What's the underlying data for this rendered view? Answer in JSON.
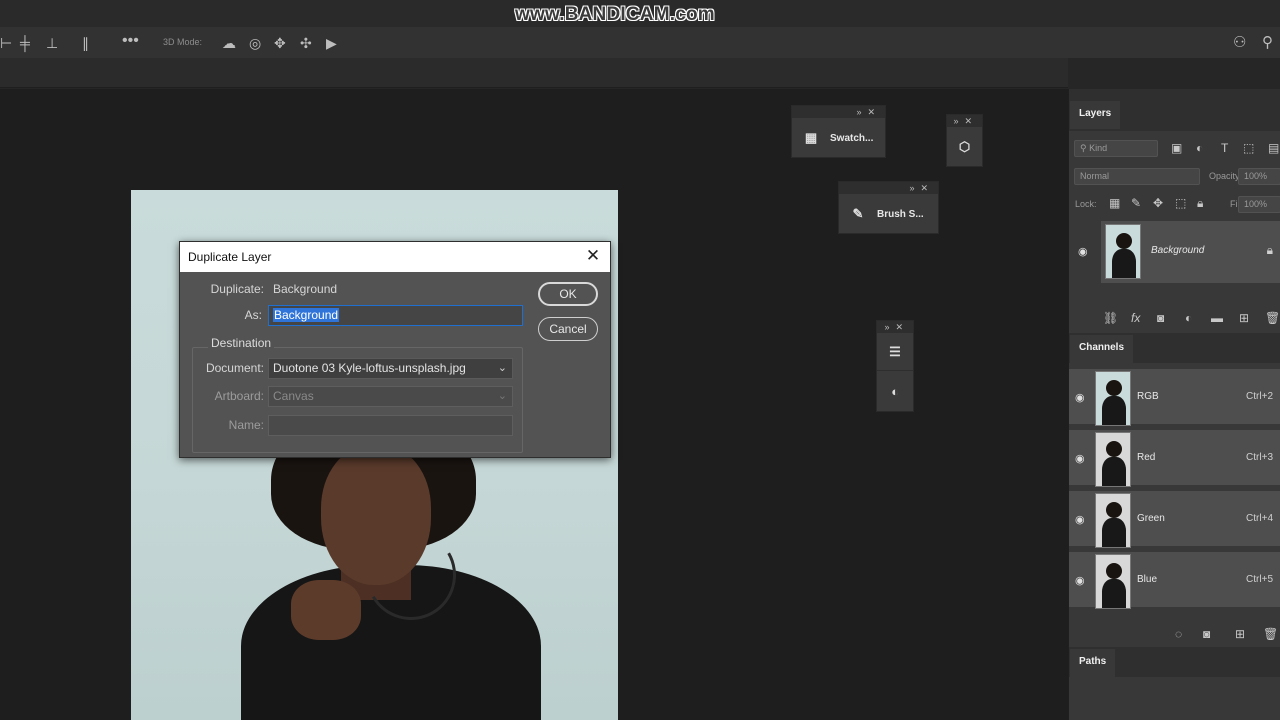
{
  "watermark": "www.BANDICAM.com",
  "options_bar": {
    "mode_label": "3D Mode:"
  },
  "floating_panels": {
    "swatches": {
      "label": "Swatch..."
    },
    "brush": {
      "label": "Brush S..."
    }
  },
  "layers_panel": {
    "tab": "Layers",
    "filter_kind": "Kind",
    "blend_mode": "Normal",
    "opacity_label": "Opacity:",
    "opacity_value": "100%",
    "lock_label": "Lock:",
    "fill_label": "Fill:",
    "fill_value": "100%",
    "layer_name": "Background"
  },
  "channels_panel": {
    "tab": "Channels",
    "channels": [
      {
        "name": "RGB",
        "shortcut": "Ctrl+2"
      },
      {
        "name": "Red",
        "shortcut": "Ctrl+3"
      },
      {
        "name": "Green",
        "shortcut": "Ctrl+4"
      },
      {
        "name": "Blue",
        "shortcut": "Ctrl+5"
      }
    ]
  },
  "paths_panel": {
    "tab": "Paths"
  },
  "dialog": {
    "title": "Duplicate Layer",
    "duplicate_label": "Duplicate:",
    "duplicate_value": "Background",
    "as_label": "As:",
    "as_value": "Background",
    "destination_label": "Destination",
    "document_label": "Document:",
    "document_value": "Duotone 03 Kyle-loftus-unsplash.jpg",
    "artboard_label": "Artboard:",
    "artboard_value": "Canvas",
    "name_label": "Name:",
    "name_value": "",
    "ok_label": "OK",
    "cancel_label": "Cancel"
  }
}
